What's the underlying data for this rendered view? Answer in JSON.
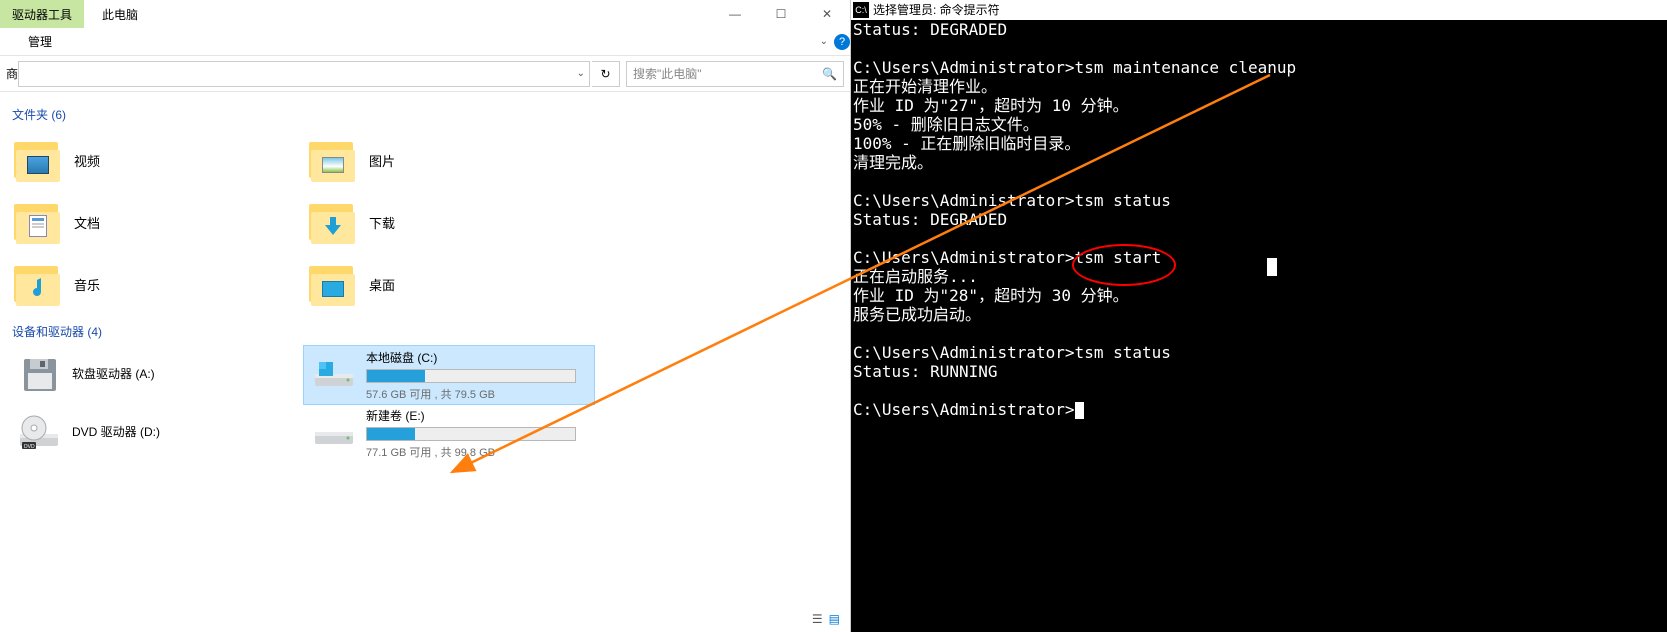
{
  "explorer": {
    "tab_tools": "驱动器工具",
    "tab_location": "此电脑",
    "ribbon_manage": "管理",
    "breadcrumb_hint": "商",
    "search_placeholder": "搜索\"此电脑\"",
    "section_folders": "文件夹 (6)",
    "section_drives": "设备和驱动器 (4)",
    "folders": {
      "video": "视频",
      "pictures": "图片",
      "documents": "文档",
      "downloads": "下载",
      "music": "音乐",
      "desktop": "桌面"
    },
    "drives": {
      "floppy": {
        "name": "软盘驱动器 (A:)"
      },
      "c": {
        "name": "本地磁盘 (C:)",
        "free": "57.6 GB 可用 , 共 79.5 GB",
        "pct": 28
      },
      "dvd": {
        "name": "DVD 驱动器 (D:)"
      },
      "e": {
        "name": "新建卷 (E:)",
        "free": "77.1 GB 可用 , 共 99.8 GB",
        "pct": 23
      }
    },
    "window_controls": {
      "min": "—",
      "max": "☐",
      "close": "✕"
    }
  },
  "terminal": {
    "title_icon": "C:\\",
    "title": "选择管理员: 命令提示符",
    "lines": [
      "Status: DEGRADED",
      "",
      "C:\\Users\\Administrator>tsm maintenance cleanup",
      "正在开始清理作业。",
      "作业 ID 为\"27\"，超时为 10 分钟。",
      "50% - 删除旧日志文件。",
      "100% - 正在删除旧临时目录。",
      "清理完成。",
      "",
      "C:\\Users\\Administrator>tsm status",
      "Status: DEGRADED",
      "",
      "C:\\Users\\Administrator>tsm start",
      "正在启动服务...",
      "作业 ID 为\"28\"，超时为 30 分钟。",
      "服务已成功启动。",
      "",
      "C:\\Users\\Administrator>tsm status",
      "Status: RUNNING",
      "",
      "C:\\Users\\Administrator>"
    ]
  }
}
